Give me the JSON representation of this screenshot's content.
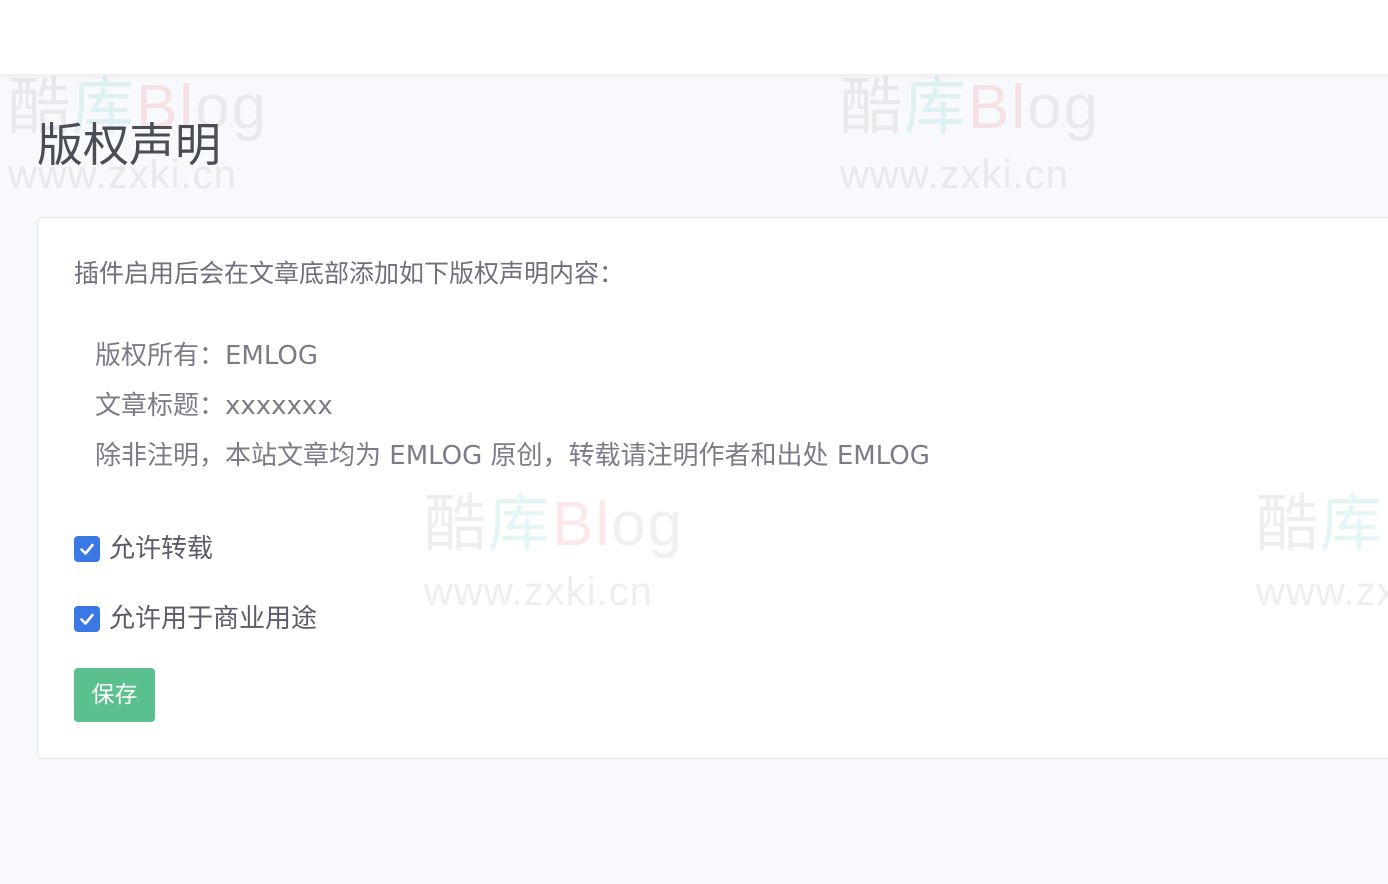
{
  "page": {
    "title": "版权声明"
  },
  "watermark": {
    "logo_part1": "酷",
    "logo_part2": "库",
    "logo_part3": "Bl",
    "logo_part4": "og",
    "url": "www.zxki.cn"
  },
  "card": {
    "intro": "插件启用后会在文章底部添加如下版权声明内容：",
    "lines": [
      "版权所有：EMLOG",
      "文章标题：xxxxxxx",
      "除非注明，本站文章均为 EMLOG 原创，转载请注明作者和出处 EMLOG"
    ]
  },
  "options": [
    {
      "label": "允许转载",
      "checked": true
    },
    {
      "label": "允许用于商业用途",
      "checked": true
    }
  ],
  "actions": {
    "save_label": "保存"
  },
  "colors": {
    "accent": "#3a78e6",
    "save_button": "#5ac18e",
    "background": "#f8f9fc"
  }
}
